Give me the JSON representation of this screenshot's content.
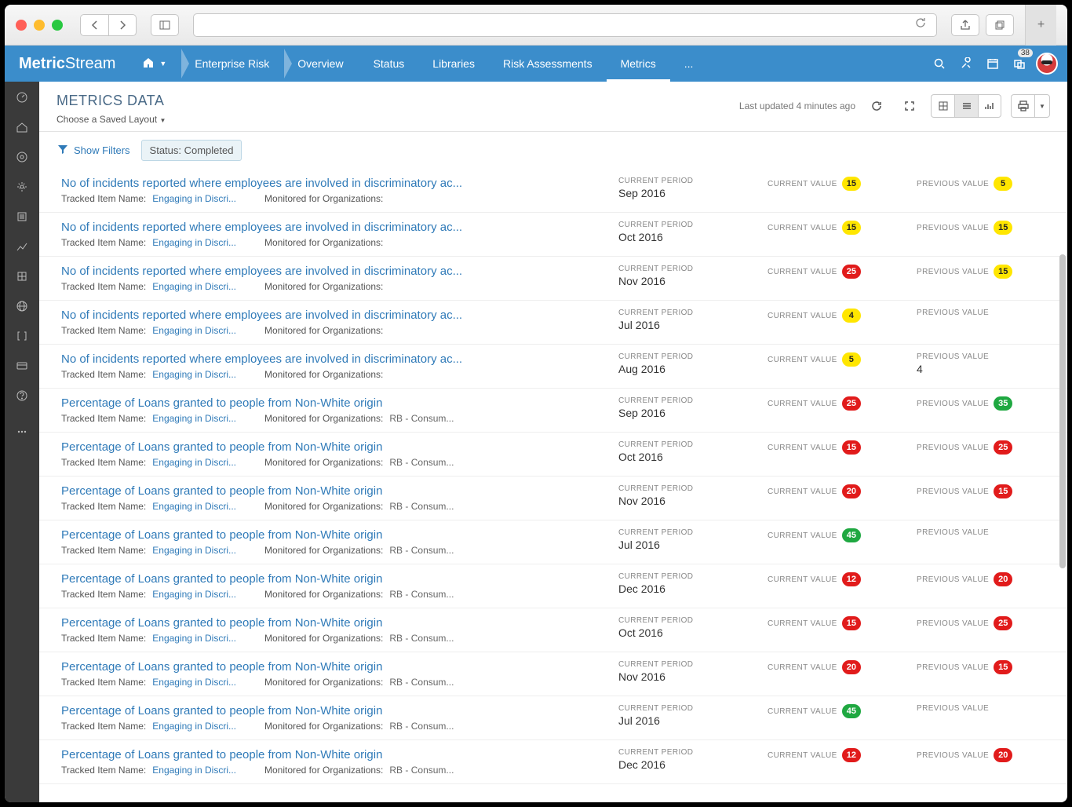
{
  "brand": {
    "a": "Metric",
    "b": "Stream"
  },
  "breadcrumb": [
    "Enterprise Risk",
    "Overview"
  ],
  "nav": {
    "status": "Status",
    "libraries": "Libraries",
    "risk": "Risk Assessments",
    "metrics": "Metrics",
    "more": "..."
  },
  "notification_count": "38",
  "page_title": "METRICS DATA",
  "layout_link": "Choose a Saved Layout",
  "last_updated": "Last updated 4 minutes ago",
  "show_filters": "Show Filters",
  "filter_chip": "Status: Completed",
  "labels": {
    "tracked": "Tracked Item Name:",
    "monitored": "Monitored for Organizations:",
    "current_period": "CURRENT PERIOD",
    "current_value": "CURRENT VALUE",
    "previous_value": "PREVIOUS VALUE"
  },
  "rows": [
    {
      "title": "No of incidents reported where employees are involved in discriminatory ac...",
      "tracked": "Engaging in Discri...",
      "org": "",
      "period": "Sep 2016",
      "cur": "15",
      "cur_c": "yellow",
      "prev": "5",
      "prev_c": "yellow"
    },
    {
      "title": "No of incidents reported where employees are involved in discriminatory ac...",
      "tracked": "Engaging in Discri...",
      "org": "",
      "period": "Oct 2016",
      "cur": "15",
      "cur_c": "yellow",
      "prev": "15",
      "prev_c": "yellow"
    },
    {
      "title": "No of incidents reported where employees are involved in discriminatory ac...",
      "tracked": "Engaging in Discri...",
      "org": "",
      "period": "Nov 2016",
      "cur": "25",
      "cur_c": "red",
      "prev": "15",
      "prev_c": "yellow"
    },
    {
      "title": "No of incidents reported where employees are involved in discriminatory ac...",
      "tracked": "Engaging in Discri...",
      "org": "",
      "period": "Jul 2016",
      "cur": "4",
      "cur_c": "yellow",
      "prev": "",
      "prev_c": ""
    },
    {
      "title": "No of incidents reported where employees are involved in discriminatory ac...",
      "tracked": "Engaging in Discri...",
      "org": "",
      "period": "Aug 2016",
      "cur": "5",
      "cur_c": "yellow",
      "prev": "4",
      "prev_c": "plain"
    },
    {
      "title": "Percentage of Loans granted to people from Non-White origin",
      "tracked": "Engaging in Discri...",
      "org": "RB - Consum...",
      "period": "Sep 2016",
      "cur": "25",
      "cur_c": "red",
      "prev": "35",
      "prev_c": "green"
    },
    {
      "title": "Percentage of Loans granted to people from Non-White origin",
      "tracked": "Engaging in Discri...",
      "org": "RB - Consum...",
      "period": "Oct 2016",
      "cur": "15",
      "cur_c": "red",
      "prev": "25",
      "prev_c": "red"
    },
    {
      "title": "Percentage of Loans granted to people from Non-White origin",
      "tracked": "Engaging in Discri...",
      "org": "RB - Consum...",
      "period": "Nov 2016",
      "cur": "20",
      "cur_c": "red",
      "prev": "15",
      "prev_c": "red"
    },
    {
      "title": "Percentage of Loans granted to people from Non-White origin",
      "tracked": "Engaging in Discri...",
      "org": "RB - Consum...",
      "period": "Jul 2016",
      "cur": "45",
      "cur_c": "green",
      "prev": "",
      "prev_c": ""
    },
    {
      "title": "Percentage of Loans granted to people from Non-White origin",
      "tracked": "Engaging in Discri...",
      "org": "RB - Consum...",
      "period": "Dec 2016",
      "cur": "12",
      "cur_c": "red",
      "prev": "20",
      "prev_c": "red"
    },
    {
      "title": "Percentage of Loans granted to people from Non-White origin",
      "tracked": "Engaging in Discri...",
      "org": "RB - Consum...",
      "period": "Oct 2016",
      "cur": "15",
      "cur_c": "red",
      "prev": "25",
      "prev_c": "red"
    },
    {
      "title": "Percentage of Loans granted to people from Non-White origin",
      "tracked": "Engaging in Discri...",
      "org": "RB - Consum...",
      "period": "Nov 2016",
      "cur": "20",
      "cur_c": "red",
      "prev": "15",
      "prev_c": "red"
    },
    {
      "title": "Percentage of Loans granted to people from Non-White origin",
      "tracked": "Engaging in Discri...",
      "org": "RB - Consum...",
      "period": "Jul 2016",
      "cur": "45",
      "cur_c": "green",
      "prev": "",
      "prev_c": ""
    },
    {
      "title": "Percentage of Loans granted to people from Non-White origin",
      "tracked": "Engaging in Discri...",
      "org": "RB - Consum...",
      "period": "Dec 2016",
      "cur": "12",
      "cur_c": "red",
      "prev": "20",
      "prev_c": "red"
    }
  ]
}
